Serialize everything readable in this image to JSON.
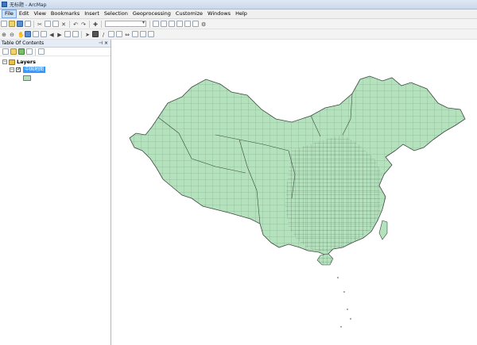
{
  "window": {
    "title": "无标题 - ArcMap"
  },
  "menu": {
    "items": [
      "File",
      "Edit",
      "View",
      "Bookmarks",
      "Insert",
      "Selection",
      "Geoprocessing",
      "Customize",
      "Windows",
      "Help"
    ]
  },
  "toc": {
    "title": "Table Of Contents",
    "root_label": "Layers",
    "layer_name": "中国地图"
  },
  "colors": {
    "map_fill": "#b3e2bd",
    "map_stroke": "#3b4a3f",
    "selection": "#3399ff"
  },
  "icons": [
    "new-icon",
    "open-icon",
    "save-icon",
    "print-icon",
    "cut-icon",
    "copy-icon",
    "paste-icon",
    "delete-icon",
    "undo-icon",
    "redo-icon",
    "add-data-icon",
    "zoom-in-icon",
    "zoom-out-icon",
    "pan-icon",
    "full-extent-icon",
    "back-icon",
    "forward-icon",
    "select-icon",
    "identify-icon",
    "measure-icon",
    "pin-icon",
    "close-icon"
  ]
}
